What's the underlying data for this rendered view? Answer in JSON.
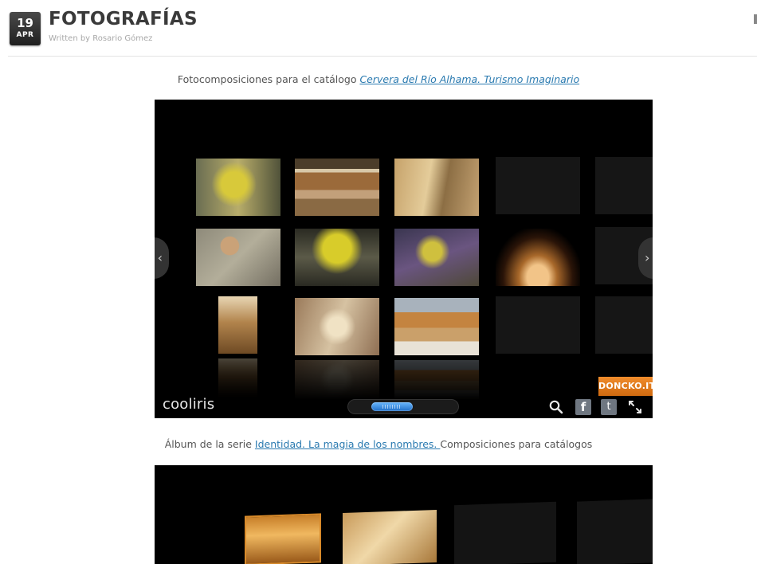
{
  "post": {
    "date_day": "19",
    "date_month": "APR",
    "title": "FOTOGRAFÍAS",
    "author": "Written by Rosario Gómez"
  },
  "section1": {
    "caption_prefix": "Fotocomposiciones para el catálogo ",
    "caption_link": "Cervera del Río Alhama. Turismo Imaginario"
  },
  "gallery": {
    "brand": "cooliris",
    "ad_label": "DONCKO.IT",
    "prev_glyph": "‹",
    "next_glyph": "›",
    "facebook_glyph": "f",
    "twitter_glyph": "t",
    "scroll_position": 0.33
  },
  "section2": {
    "caption_prefix": "Álbum de la serie ",
    "caption_link": "Identidad. La magia de los nombres. ",
    "caption_suffix": "Composiciones para catálogos"
  },
  "icons": [
    "search-icon",
    "facebook-icon",
    "twitter-icon",
    "fullscreen-icon",
    "chevron-left-icon",
    "chevron-right-icon"
  ],
  "colors": {
    "link": "#2a7ab0",
    "gallery_background": "#000000",
    "ad_orange": "#e07a1c",
    "scroll_blue": "#3a8fe8"
  }
}
